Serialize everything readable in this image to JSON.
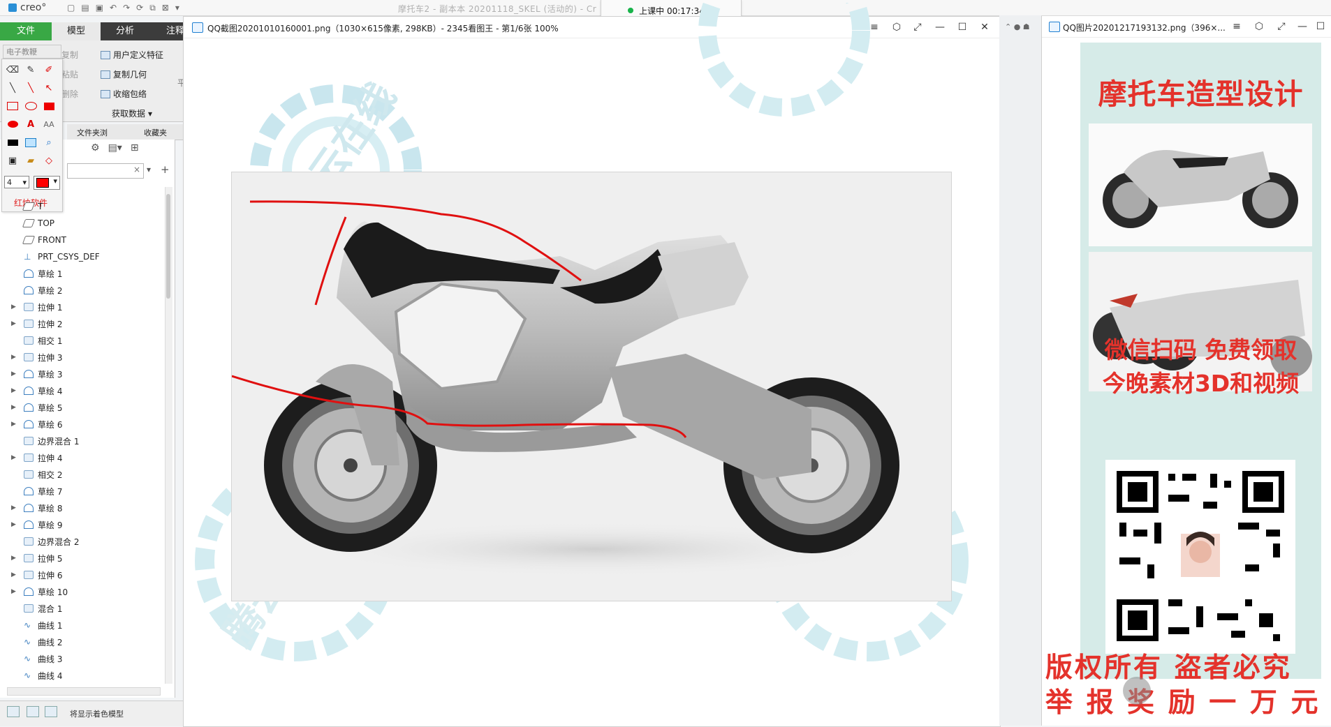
{
  "creo": {
    "logo_text": "creo°",
    "window_title": "摩托车2 - 副本本 20201118_SKEL (活动的) - Cr",
    "tabs": [
      "文件",
      "模型",
      "分析",
      "注释"
    ],
    "ribbon": {
      "clipboard_label": "电子教鞭",
      "copy": "复制",
      "paste": "粘贴",
      "delete": "删除",
      "user_feature": "用户定义特征",
      "copy_geometry": "复制几何",
      "shrinkwrap": "收缩包络",
      "get_data": "获取数据",
      "plane_hint": "平"
    },
    "nav_tabs": [
      "文件夹浏",
      "收藏夹"
    ],
    "tree_items": [
      {
        "label": "T",
        "icon": "plane",
        "expand": false
      },
      {
        "label": "TOP",
        "icon": "plane",
        "expand": false
      },
      {
        "label": "FRONT",
        "icon": "plane",
        "expand": false
      },
      {
        "label": "PRT_CSYS_DEF",
        "icon": "csys",
        "expand": false
      },
      {
        "label": "草绘 1",
        "icon": "sketch",
        "expand": false
      },
      {
        "label": "草绘 2",
        "icon": "sketch",
        "expand": false
      },
      {
        "label": "拉伸 1",
        "icon": "extrude",
        "expand": true
      },
      {
        "label": "拉伸 2",
        "icon": "extrude",
        "expand": true
      },
      {
        "label": "相交 1",
        "icon": "intersect",
        "expand": false
      },
      {
        "label": "拉伸 3",
        "icon": "extrude",
        "expand": true
      },
      {
        "label": "草绘 3",
        "icon": "sketch",
        "expand": true
      },
      {
        "label": "草绘 4",
        "icon": "sketch",
        "expand": true
      },
      {
        "label": "草绘 5",
        "icon": "sketch",
        "expand": true
      },
      {
        "label": "草绘 6",
        "icon": "sketch",
        "expand": true
      },
      {
        "label": "边界混合 1",
        "icon": "blend",
        "expand": false
      },
      {
        "label": "拉伸 4",
        "icon": "extrude",
        "expand": true
      },
      {
        "label": "相交 2",
        "icon": "intersect",
        "expand": false
      },
      {
        "label": "草绘 7",
        "icon": "sketch",
        "expand": false
      },
      {
        "label": "草绘 8",
        "icon": "sketch",
        "expand": true
      },
      {
        "label": "草绘 9",
        "icon": "sketch",
        "expand": true
      },
      {
        "label": "边界混合 2",
        "icon": "blend",
        "expand": false
      },
      {
        "label": "拉伸 5",
        "icon": "extrude",
        "expand": true
      },
      {
        "label": "拉伸 6",
        "icon": "extrude",
        "expand": true
      },
      {
        "label": "草绘 10",
        "icon": "sketch",
        "expand": true
      },
      {
        "label": "混合 1",
        "icon": "blend",
        "expand": false
      },
      {
        "label": "曲线 1",
        "icon": "curve",
        "expand": false
      },
      {
        "label": "曲线 2",
        "icon": "curve",
        "expand": false
      },
      {
        "label": "曲线 3",
        "icon": "curve",
        "expand": false
      },
      {
        "label": "曲线 4",
        "icon": "curve",
        "expand": false
      }
    ],
    "status_text": "将显示着色模型"
  },
  "live": {
    "label": "上课中 00:17:34",
    "dropdown": "˅"
  },
  "palette": {
    "size_value": "4",
    "app_name": "红烛软件",
    "color": "#ff0000"
  },
  "viewer1": {
    "title": "QQ截图20201010160001.png（1030×615像素, 298KB）- 2345看图王 - 第1/6张 100%"
  },
  "viewer2": {
    "title": "QQ图片20201217193132.png（396×...",
    "ad_title": "摩托车造型设计",
    "line1": "微信扫码 免费领取",
    "line2": "今晚素材3D和视频",
    "copyright1": "版权所有 盗者必究",
    "copyright2": "举 报 奖 励 一 万 元"
  },
  "watermark": {
    "text": "腾云在线"
  },
  "colors": {
    "creo_green": "#39a845",
    "accent_red": "#e4322b",
    "ad_bg": "#d6ebe8"
  }
}
